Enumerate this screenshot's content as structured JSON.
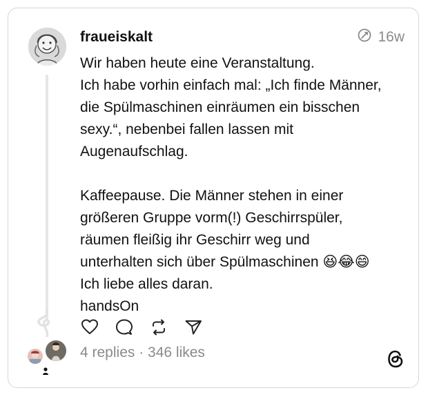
{
  "post": {
    "username": "fraueiskalt",
    "time": "16w",
    "lines": [
      "Wir haben heute eine Veranstaltung.",
      "Ich habe vorhin einfach mal: „Ich finde Männer,",
      "die Spülmaschinen einräumen ein bisschen",
      "sexy.“, nebenbei fallen lassen mit",
      "Augenaufschlag."
    ],
    "lines2": [
      "Kaffeepause. Die Männer stehen in einer",
      "größeren Gruppe vorm(!) Geschirrspüler,",
      "räumen fleißig ihr Geschirr weg und",
      "unterhalten sich über Spülmaschinen 😆😂😄",
      "Ich liebe alles daran.",
      "handsOn"
    ],
    "stats": "4 replies · 346 likes"
  },
  "icons": {
    "time": "edited-clock-icon",
    "like": "heart-icon",
    "reply": "comment-icon",
    "repost": "repost-icon",
    "share": "send-icon",
    "brand": "threads-logo-icon"
  },
  "colors": {
    "border": "#d6d6d6",
    "muted": "#8a8a8a",
    "text": "#111111",
    "thread_line": "#e6e6e6"
  }
}
